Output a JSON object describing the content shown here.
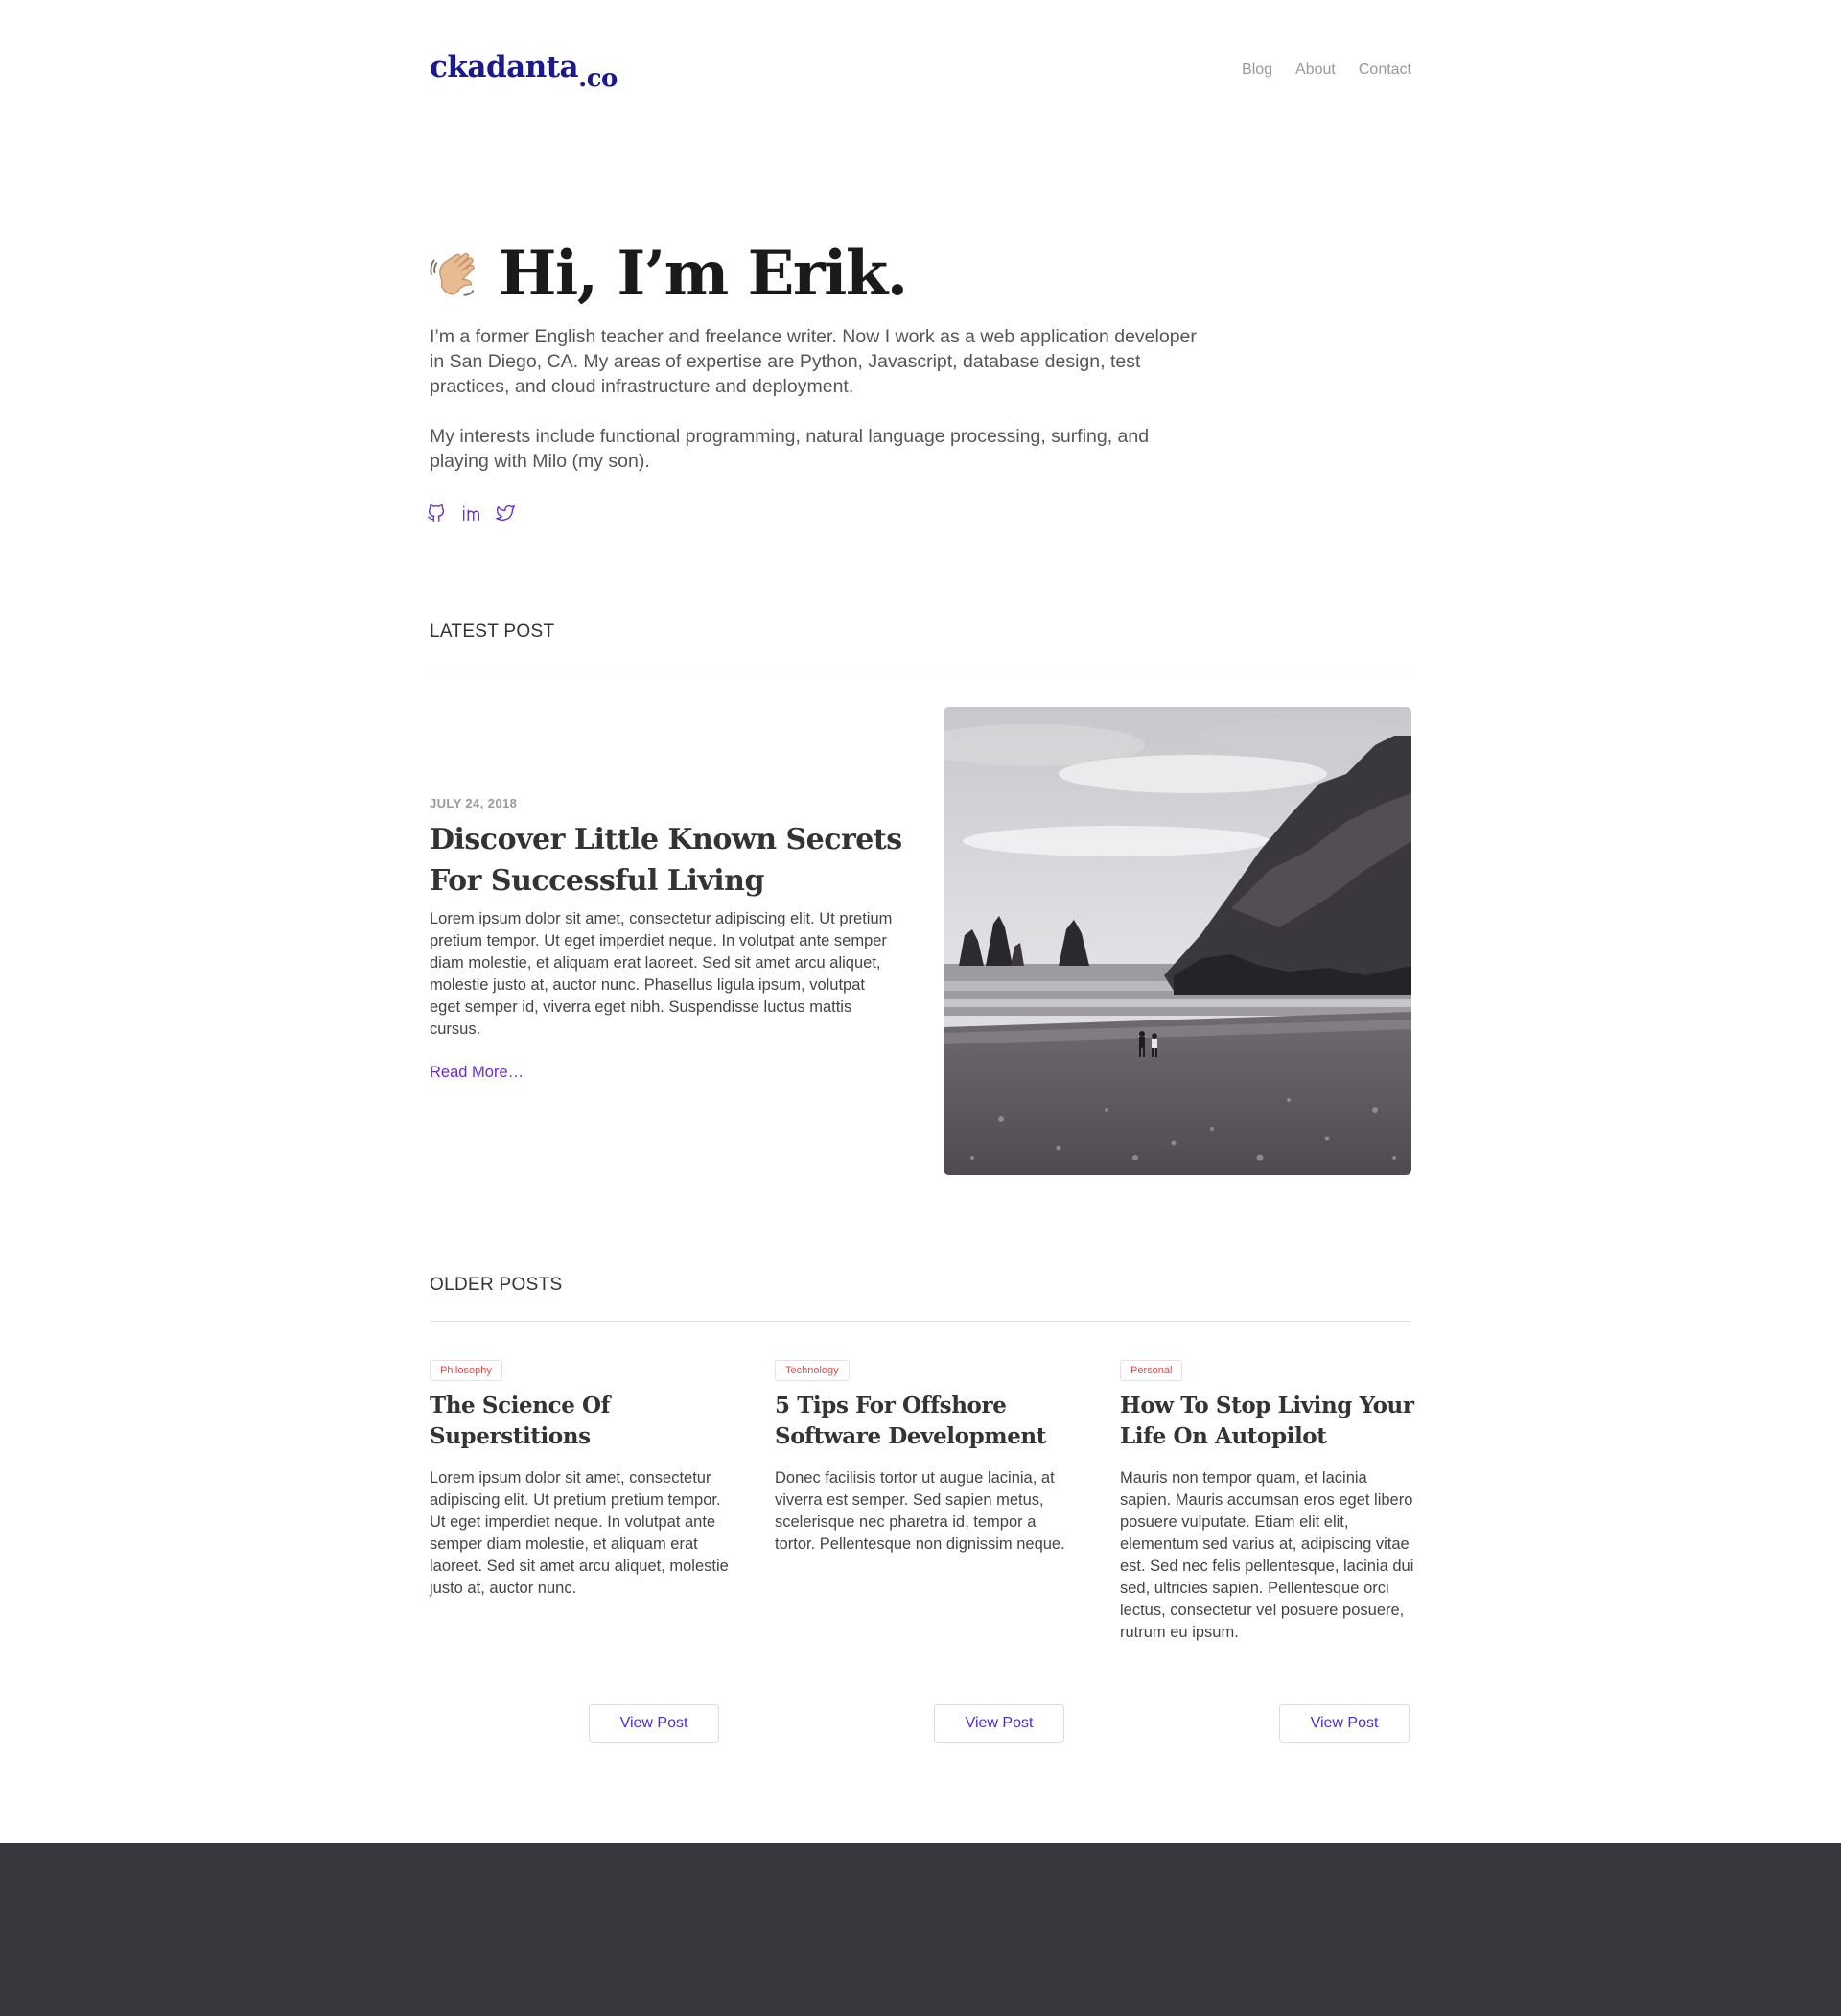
{
  "header": {
    "logo_main": "ckadanta",
    "logo_tld": ".co",
    "nav": [
      {
        "label": "Blog"
      },
      {
        "label": "About"
      },
      {
        "label": "Contact"
      }
    ]
  },
  "hero": {
    "title": "Hi, I’m Erik.",
    "icon": "waving-hand-icon",
    "paragraphs": [
      "I’m a former English teacher and freelance writer. Now I work as a web application developer in San Diego, CA. My areas of expertise are Python, Javascript, database design, test practices, and cloud infrastructure and deployment.",
      "My interests include functional programming, natural language processing, surfing, and playing with Milo (my son)."
    ],
    "socials": [
      "github-icon",
      "linkedin-icon",
      "twitter-icon"
    ],
    "accent_color": "#6a2bd6"
  },
  "latest": {
    "section_title": "LATEST POST",
    "date": "JULY 24, 2018",
    "title": "Discover Little Known Secrets For Successful Living",
    "excerpt": "Lorem ipsum dolor sit amet, consectetur adipiscing elit. Ut pretium pretium tempor. Ut eget imperdiet neque. In volutpat ante semper diam molestie, et aliquam erat laoreet. Sed sit amet arcu aliquet, molestie justo at, auctor nunc. Phasellus ligula ipsum, volutpat eget semper id, viverra eget nibh. Suspendisse luctus mattis cursus.",
    "read_more": "Read More…",
    "image": "black-and-white-beach-cliffs-photo"
  },
  "older": {
    "section_title": "OLDER POSTS",
    "posts": [
      {
        "tag": "Philosophy",
        "title": "The Science Of Superstitions",
        "excerpt": "Lorem ipsum dolor sit amet, consectetur adipiscing elit. Ut pretium pretium tempor. Ut eget imperdiet neque. In volutpat ante semper diam molestie, et aliquam erat laoreet. Sed sit amet arcu aliquet, molestie justo at, auctor nunc.",
        "button": "View Post"
      },
      {
        "tag": "Technology",
        "title": "5 Tips For Offshore Software Development",
        "excerpt": "Donec facilisis tortor ut augue lacinia, at viverra est semper. Sed sapien metus, scelerisque nec pharetra id, tempor a tortor. Pellentesque non dignissim neque.",
        "button": "View Post"
      },
      {
        "tag": "Personal",
        "title": "How To Stop Living Your Life On Autopilot",
        "excerpt": "Mauris non tempor quam, et lacinia sapien. Mauris accumsan eros eget libero posuere vulputate. Etiam elit elit, elementum sed varius at, adipiscing vitae est. Sed nec felis pellentesque, lacinia dui sed, ultricies sapien. Pellentesque orci lectus, consectetur vel posuere posuere, rutrum eu ipsum.",
        "button": "View Post"
      }
    ]
  },
  "footer": {
    "background": "#3a363e"
  }
}
